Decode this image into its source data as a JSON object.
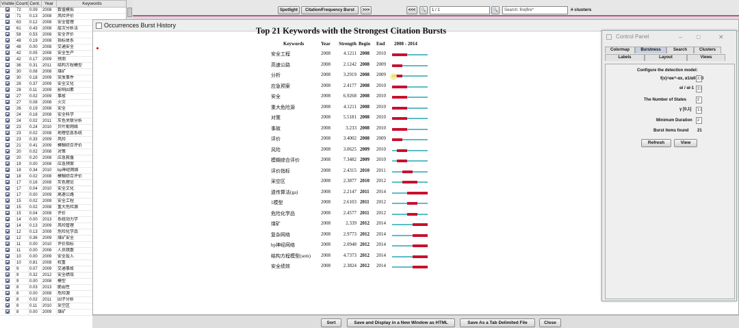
{
  "left_table": {
    "headers": [
      "Visible",
      "Count",
      "Cent.",
      "Year",
      "Keywords"
    ],
    "rows": [
      [
        "72",
        "0.09",
        "2008",
        "数值模拟"
      ],
      [
        "71",
        "0.13",
        "2008",
        "风险评价"
      ],
      [
        "63",
        "0.12",
        "2008",
        "安全管理"
      ],
      [
        "61",
        "0.43",
        "2008",
        "层次分析法"
      ],
      [
        "58",
        "0.53",
        "2008",
        "安全评价"
      ],
      [
        "48",
        "0.19",
        "2008",
        "指标体系"
      ],
      [
        "48",
        "0.00",
        "2008",
        "交通安全"
      ],
      [
        "42",
        "0.05",
        "2008",
        "安全生产"
      ],
      [
        "42",
        "0.17",
        "2009",
        "预测"
      ],
      [
        "36",
        "0.31",
        "2011",
        "结构方程模型"
      ],
      [
        "30",
        "0.08",
        "2008",
        "煤矿"
      ],
      [
        "30",
        "0.18",
        "2009",
        "突发事件"
      ],
      [
        "28",
        "0.37",
        "2009",
        "安全文化"
      ],
      [
        "28",
        "0.11",
        "2009",
        "影响因素"
      ],
      [
        "27",
        "0.02",
        "2009",
        "事故"
      ],
      [
        "27",
        "0.08",
        "2008",
        "火灾"
      ],
      [
        "26",
        "0.19",
        "2008",
        "安全"
      ],
      [
        "24",
        "0.18",
        "2008",
        "安全科学"
      ],
      [
        "24",
        "0.02",
        "2011",
        "灰色关联分析"
      ],
      [
        "23",
        "0.24",
        "2010",
        "贝叶斯网络"
      ],
      [
        "23",
        "0.02",
        "2008",
        "地理信息系统"
      ],
      [
        "23",
        "0.33",
        "2009",
        "风险"
      ],
      [
        "21",
        "0.41",
        "2009",
        "模糊综合评价"
      ],
      [
        "20",
        "0.02",
        "2008",
        "对策"
      ],
      [
        "20",
        "0.20",
        "2008",
        "应急救援"
      ],
      [
        "19",
        "0.00",
        "2008",
        "应急预案"
      ],
      [
        "18",
        "0.34",
        "2010",
        "bp神经网络"
      ],
      [
        "18",
        "0.02",
        "2008",
        "模糊综合评价"
      ],
      [
        "17",
        "0.16",
        "2008",
        "灰色理论"
      ],
      [
        "17",
        "0.04",
        "2010",
        "安全文化"
      ],
      [
        "17",
        "0.00",
        "2009",
        "高速公路"
      ],
      [
        "15",
        "0.02",
        "2009",
        "安全工程"
      ],
      [
        "15",
        "0.02",
        "2008",
        "重大危险源"
      ],
      [
        "15",
        "0.04",
        "2008",
        "评价"
      ],
      [
        "14",
        "0.00",
        "2013",
        "系统动力学"
      ],
      [
        "14",
        "0.13",
        "2009",
        "风险管理"
      ],
      [
        "12",
        "0.13",
        "2009",
        "危险化学品"
      ],
      [
        "12",
        "0.36",
        "2009",
        "煤矿安全"
      ],
      [
        "11",
        "0.00",
        "2010",
        "评价指标"
      ],
      [
        "11",
        "0.00",
        "2008",
        "人员疏散"
      ],
      [
        "10",
        "0.00",
        "2009",
        "安全投入"
      ],
      [
        "10",
        "0.81",
        "2008",
        "权重"
      ],
      [
        "9",
        "0.07",
        "2009",
        "交通事故"
      ],
      [
        "9",
        "0.32",
        "2012",
        "安全绩效"
      ],
      [
        "9",
        "0.00",
        "2008",
        "模型"
      ],
      [
        "8",
        "0.03",
        "2013",
        "脆弱性"
      ],
      [
        "8",
        "0.00",
        "2008",
        "危险源"
      ],
      [
        "8",
        "0.02",
        "2011",
        "因子分析"
      ],
      [
        "8",
        "0.11",
        "2010",
        "采空区"
      ],
      [
        "8",
        "0.00",
        "2009",
        "煤矿"
      ]
    ]
  },
  "toolbar": {
    "spotlight": "Spotlight",
    "cit_freq": "Citation/Frequency Burst",
    "arrows": ">>>",
    "prev": "<<<",
    "page": "1 / 1",
    "next": ">>>",
    "search_placeholder": "Search: fire|fire*",
    "clusters": "# clusters"
  },
  "window": {
    "title": "Occurrences Burst History"
  },
  "burst_table": {
    "title": "Top 21 Keywords with the Strongest Citation Bursts",
    "headers": {
      "keywords": "Keywords",
      "year": "Year",
      "strength": "Strength",
      "begin": "Begin",
      "end": "End",
      "range": "2008 - 2014"
    },
    "range_start": 2008,
    "range_end": 2014,
    "rows": [
      {
        "k": "安全工程",
        "y": "2008",
        "s": "4.1211",
        "b": "2008",
        "e": "2010"
      },
      {
        "k": "高速公路",
        "y": "2008",
        "s": "2.1242",
        "b": "2008",
        "e": "2009"
      },
      {
        "k": "分析",
        "y": "2008",
        "s": "3.2919",
        "b": "2008",
        "e": "2009"
      },
      {
        "k": "应急预案",
        "y": "2008",
        "s": "2.4177",
        "b": "2008",
        "e": "2010"
      },
      {
        "k": "安全",
        "y": "2008",
        "s": "6.9268",
        "b": "2008",
        "e": "2010"
      },
      {
        "k": "重大危险源",
        "y": "2008",
        "s": "4.1211",
        "b": "2008",
        "e": "2010"
      },
      {
        "k": "对策",
        "y": "2008",
        "s": "5.5181",
        "b": "2008",
        "e": "2010"
      },
      {
        "k": "事故",
        "y": "2008",
        "s": "3.233",
        "b": "2008",
        "e": "2010"
      },
      {
        "k": "评价",
        "y": "2008",
        "s": "3.4002",
        "b": "2008",
        "e": "2009"
      },
      {
        "k": "风险",
        "y": "2008",
        "s": "3.0625",
        "b": "2009",
        "e": "2010"
      },
      {
        "k": "模糊综合评价",
        "y": "2008",
        "s": "7.3482",
        "b": "2009",
        "e": "2010"
      },
      {
        "k": "评价指标",
        "y": "2008",
        "s": "2.4315",
        "b": "2010",
        "e": "2011"
      },
      {
        "k": "采空区",
        "y": "2008",
        "s": "2.3877",
        "b": "2010",
        "e": "2012"
      },
      {
        "k": "遗传算法(ga)",
        "y": "2008",
        "s": "2.2147",
        "b": "2011",
        "e": "2014"
      },
      {
        "k": "1模型",
        "y": "2008",
        "s": "2.6103",
        "b": "2011",
        "e": "2012"
      },
      {
        "k": "危险化学品",
        "y": "2008",
        "s": "2.4577",
        "b": "2011",
        "e": "2012"
      },
      {
        "k": "煤矿",
        "y": "2008",
        "s": "2.339",
        "b": "2012",
        "e": "2014"
      },
      {
        "k": "复杂网络",
        "y": "2008",
        "s": "2.9773",
        "b": "2012",
        "e": "2014"
      },
      {
        "k": "bp神经网络",
        "y": "2008",
        "s": "2.0948",
        "b": "2012",
        "e": "2014"
      },
      {
        "k": "结构方程模型(sem)",
        "y": "2008",
        "s": "4.7373",
        "b": "2012",
        "e": "2014"
      },
      {
        "k": "安全绩效",
        "y": "2008",
        "s": "2.3824",
        "b": "2012",
        "e": "2014"
      }
    ]
  },
  "bottom_buttons": {
    "sort": "Sort",
    "save_html": "Save and Display in a New Window as HTML",
    "save_tab": "Save As a Tab Delimited File",
    "close": "Close"
  },
  "control_panel": {
    "title": "Control Panel",
    "tabs_row1": [
      "Colormap",
      "Burstness",
      "Search",
      "Clusters"
    ],
    "tabs_row2": [
      "Labels",
      "Layout",
      "Views"
    ],
    "configure": "Configure the detection model:",
    "formula": "f(x)=αe^-αx, α1/α0=2.0",
    "ratio_label": "αi / αi-1",
    "alpha1": "2.0",
    "alpha2": "2.0",
    "num_states_label": "The Number of States",
    "num_states": "2",
    "gamma_label": "γ [0,1]",
    "gamma": "1.0",
    "min_duration_label": "Minimum Duration",
    "min_duration": "2",
    "found_label": "Burst items found",
    "found": "21",
    "refresh": "Refresh",
    "view": "View"
  }
}
